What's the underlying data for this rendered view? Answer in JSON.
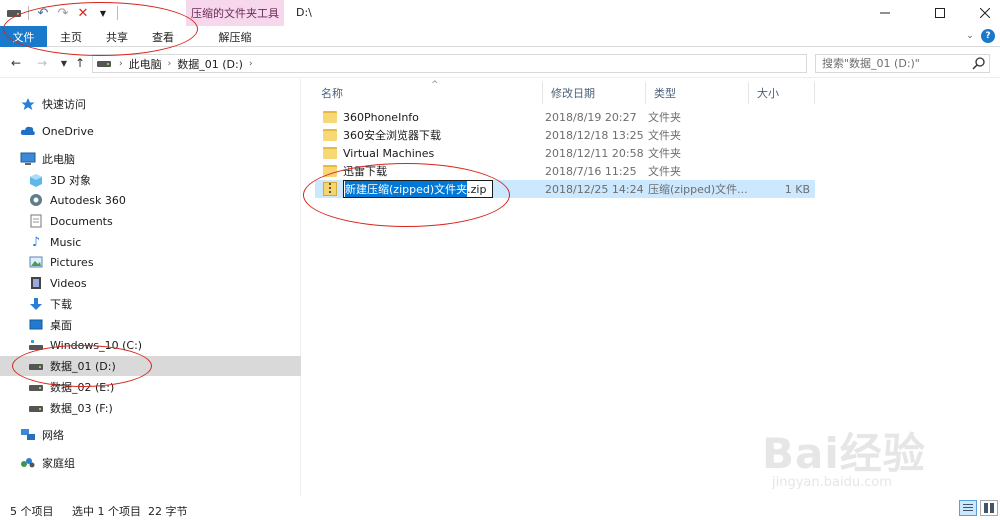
{
  "window": {
    "path": "D:\\",
    "context_tab_header": "压缩的文件夹工具"
  },
  "ribbon": {
    "tabs": [
      "文件",
      "主页",
      "共享",
      "查看"
    ],
    "context_tab": "解压缩"
  },
  "address": {
    "crumbs": [
      "此电脑",
      "数据_01 (D:)"
    ],
    "search_placeholder": "搜索\"数据_01 (D:)\""
  },
  "nav": {
    "items": [
      {
        "label": "快速访问",
        "icon": "star-icon"
      },
      {
        "label": "OneDrive",
        "icon": "cloud-icon"
      },
      {
        "label": "此电脑",
        "icon": "computer-icon"
      },
      {
        "label": "3D 对象",
        "icon": "3d-objects-icon"
      },
      {
        "label": "Autodesk 360",
        "icon": "autodesk-icon"
      },
      {
        "label": "Documents",
        "icon": "document-icon"
      },
      {
        "label": "Music",
        "icon": "music-icon"
      },
      {
        "label": "Pictures",
        "icon": "picture-icon"
      },
      {
        "label": "Videos",
        "icon": "video-icon"
      },
      {
        "label": "下载",
        "icon": "download-icon"
      },
      {
        "label": "桌面",
        "icon": "desktop-icon"
      },
      {
        "label": "Windows_10 (C:)",
        "icon": "drive-icon"
      },
      {
        "label": "数据_01 (D:)",
        "icon": "drive-icon"
      },
      {
        "label": "数据_02 (E:)",
        "icon": "drive-icon"
      },
      {
        "label": "数据_03 (F:)",
        "icon": "drive-icon"
      },
      {
        "label": "网络",
        "icon": "network-icon"
      },
      {
        "label": "家庭组",
        "icon": "homegroup-icon"
      }
    ]
  },
  "columns": {
    "name": "名称",
    "modified": "修改日期",
    "type": "类型",
    "size": "大小"
  },
  "files": [
    {
      "name": "360PhoneInfo",
      "modified": "2018/8/19 20:27",
      "type": "文件夹",
      "size": ""
    },
    {
      "name": "360安全浏览器下载",
      "modified": "2018/12/18 13:25",
      "type": "文件夹",
      "size": ""
    },
    {
      "name": "Virtual Machines",
      "modified": "2018/12/11 20:58",
      "type": "文件夹",
      "size": ""
    },
    {
      "name": "迅雷下载",
      "modified": "2018/7/16 11:25",
      "type": "文件夹",
      "size": ""
    },
    {
      "name_selected": "新建压缩(zipped)文件夹",
      "name_ext": ".zip",
      "modified": "2018/12/25 14:24",
      "type": "压缩(zipped)文件...",
      "size": "1 KB"
    }
  ],
  "status": {
    "count": "5 个项目",
    "selection": "选中 1 个项目  22 字节"
  },
  "watermark": {
    "big": "Bai经验",
    "small": "jingyan.baidu.com"
  },
  "colors": {
    "accent": "#1979ca",
    "context_tab": "#f6d7ec",
    "selection": "#cce8ff",
    "annotation": "#d8261d"
  }
}
